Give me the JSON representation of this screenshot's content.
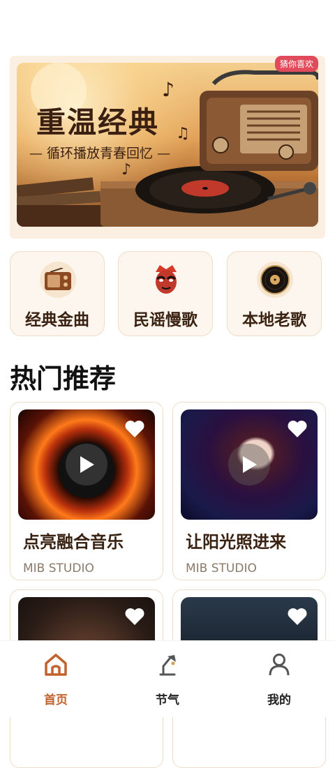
{
  "banner": {
    "badge": "猜你喜欢",
    "title": "重温经典",
    "subtitle": "— 循环播放青春回忆 —"
  },
  "categories": [
    {
      "label": "经典金曲",
      "icon": "radio-icon"
    },
    {
      "label": "民谣慢歌",
      "icon": "opera-mask-icon"
    },
    {
      "label": "本地老歌",
      "icon": "vinyl-record-icon"
    }
  ],
  "section": {
    "title": "热门推荐"
  },
  "songs": [
    {
      "title": "点亮融合音乐",
      "studio": "MIB STUDIO"
    },
    {
      "title": "让阳光照进来",
      "studio": "MIB STUDIO"
    },
    {
      "title": "",
      "studio": ""
    },
    {
      "title": "",
      "studio": ""
    }
  ],
  "nav": [
    {
      "label": "首页",
      "icon": "home-icon",
      "active": true
    },
    {
      "label": "节气",
      "icon": "lamp-icon",
      "active": false
    },
    {
      "label": "我的",
      "icon": "user-icon",
      "active": false
    }
  ],
  "colors": {
    "accent": "#c2622d",
    "badge": "#e04a5a",
    "card_border": "#f0dcc6"
  }
}
